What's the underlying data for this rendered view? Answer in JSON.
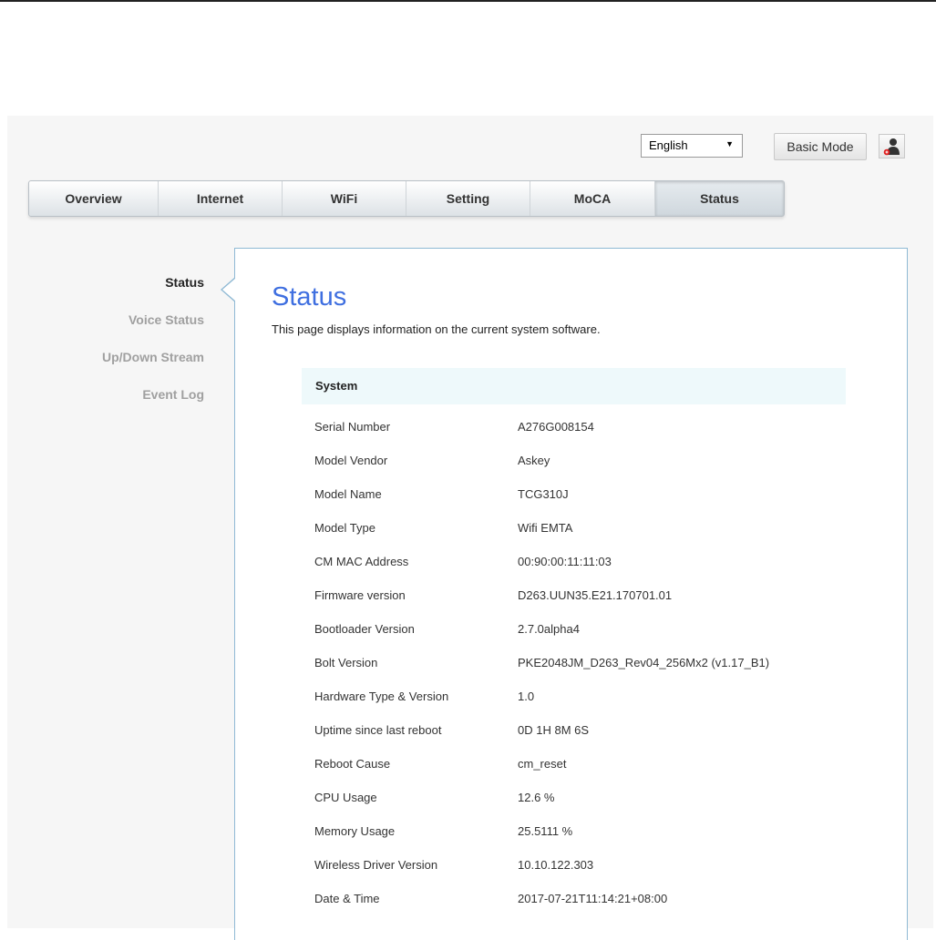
{
  "topbar": {
    "language": "English",
    "basic_mode_label": "Basic Mode",
    "user_icon": "user-icon"
  },
  "tabs": [
    {
      "label": "Overview",
      "active": false
    },
    {
      "label": "Internet",
      "active": false
    },
    {
      "label": "WiFi",
      "active": false
    },
    {
      "label": "Setting",
      "active": false
    },
    {
      "label": "MoCA",
      "active": false
    },
    {
      "label": "Status",
      "active": true
    }
  ],
  "subnav": [
    {
      "label": "Status",
      "active": true
    },
    {
      "label": "Voice Status",
      "active": false
    },
    {
      "label": "Up/Down Stream",
      "active": false
    },
    {
      "label": "Event Log",
      "active": false
    }
  ],
  "main": {
    "title": "Status",
    "description": "This page displays information on the current system software.",
    "section_title": "System",
    "rows": [
      {
        "label": "Serial Number",
        "value": "A276G008154"
      },
      {
        "label": "Model Vendor",
        "value": "Askey"
      },
      {
        "label": "Model Name",
        "value": "TCG310J"
      },
      {
        "label": "Model Type",
        "value": "Wifi EMTA"
      },
      {
        "label": "CM MAC Address",
        "value": "00:90:00:11:11:03"
      },
      {
        "label": "Firmware version",
        "value": "D263.UUN35.E21.170701.01"
      },
      {
        "label": "Bootloader Version",
        "value": "2.7.0alpha4"
      },
      {
        "label": "Bolt Version",
        "value": "PKE2048JM_D263_Rev04_256Mx2 (v1.17_B1)"
      },
      {
        "label": "Hardware Type & Version",
        "value": "1.0"
      },
      {
        "label": "Uptime since last reboot",
        "value": "0D 1H 8M 6S"
      },
      {
        "label": "Reboot Cause",
        "value": "cm_reset"
      },
      {
        "label": "CPU Usage",
        "value": "12.6 %"
      },
      {
        "label": "Memory Usage",
        "value": "25.5111 %"
      },
      {
        "label": "Wireless Driver Version",
        "value": "10.10.122.303"
      },
      {
        "label": "Date & Time",
        "value": "2017-07-21T11:14:21+08:00"
      }
    ]
  },
  "colors": {
    "accent": "#3f6fe0",
    "panel_border": "#8fb9d4",
    "section_bg": "#eef9fb"
  }
}
